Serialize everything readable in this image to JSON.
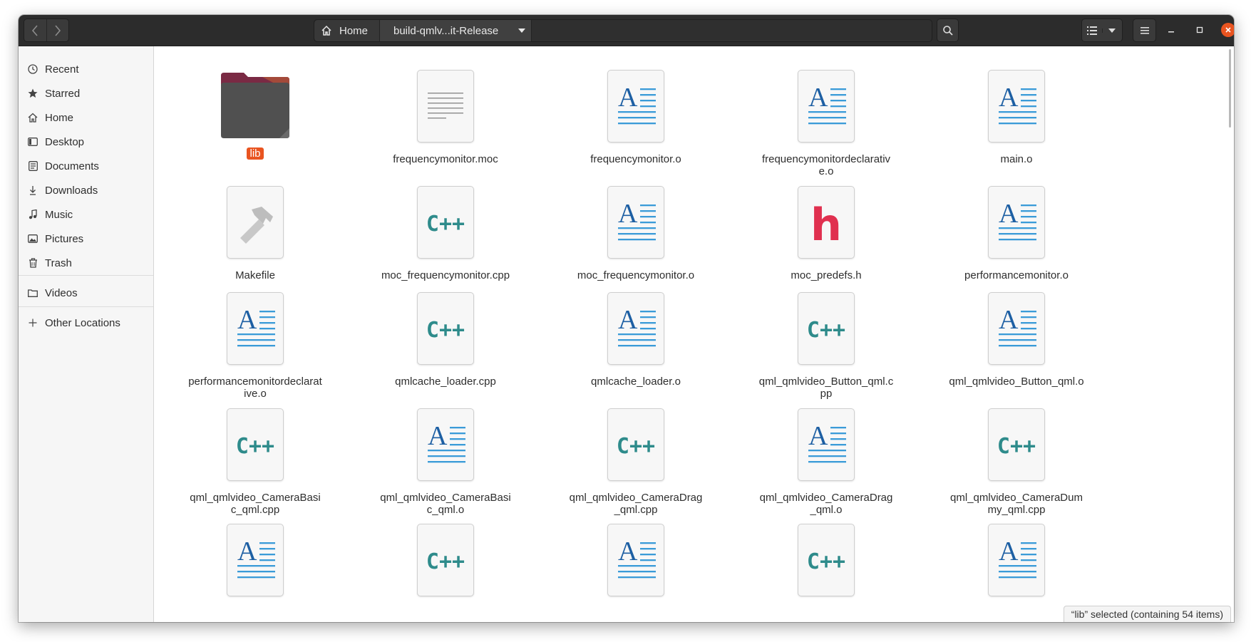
{
  "header": {
    "back_icon": "go-back-icon",
    "forward_icon": "go-forward-icon",
    "path": {
      "home_label": "Home",
      "current_label": "build-qmlv...it-Release"
    },
    "search_icon": "search-icon",
    "view_icon": "list-view-icon",
    "menu_icon": "hamburger-menu-icon",
    "close_color": "#e95420"
  },
  "sidebar": {
    "items": [
      {
        "label": "Recent",
        "icon": "recent-icon"
      },
      {
        "label": "Starred",
        "icon": "star-icon"
      },
      {
        "label": "Home",
        "icon": "home-icon"
      },
      {
        "label": "Desktop",
        "icon": "desktop-icon"
      },
      {
        "label": "Documents",
        "icon": "documents-icon"
      },
      {
        "label": "Downloads",
        "icon": "downloads-icon"
      },
      {
        "label": "Music",
        "icon": "music-icon"
      },
      {
        "label": "Pictures",
        "icon": "pictures-icon"
      },
      {
        "label": "Trash",
        "icon": "trash-icon"
      },
      {
        "label": "Videos",
        "icon": "videos-icon"
      },
      {
        "label": "Other Locations",
        "icon": "plus-icon"
      }
    ]
  },
  "files": [
    {
      "name": "lib",
      "type": "folder",
      "selected": true
    },
    {
      "name": "frequencymonitor.moc",
      "type": "text"
    },
    {
      "name": "frequencymonitor.o",
      "type": "object"
    },
    {
      "name": "frequencymonitordeclarative.o",
      "type": "object"
    },
    {
      "name": "main.o",
      "type": "object"
    },
    {
      "name": "Makefile",
      "type": "makefile"
    },
    {
      "name": "moc_frequencymonitor.cpp",
      "type": "cpp"
    },
    {
      "name": "moc_frequencymonitor.o",
      "type": "object"
    },
    {
      "name": "moc_predefs.h",
      "type": "header"
    },
    {
      "name": "performancemonitor.o",
      "type": "object"
    },
    {
      "name": "performancemonitordeclarative.o",
      "type": "object"
    },
    {
      "name": "qmlcache_loader.cpp",
      "type": "cpp"
    },
    {
      "name": "qmlcache_loader.o",
      "type": "object"
    },
    {
      "name": "qml_qmlvideo_Button_qml.cpp",
      "type": "cpp"
    },
    {
      "name": "qml_qmlvideo_Button_qml.o",
      "type": "object"
    },
    {
      "name": "qml_qmlvideo_CameraBasic_qml.cpp",
      "type": "cpp"
    },
    {
      "name": "qml_qmlvideo_CameraBasic_qml.o",
      "type": "object"
    },
    {
      "name": "qml_qmlvideo_CameraDrag_qml.cpp",
      "type": "cpp"
    },
    {
      "name": "qml_qmlvideo_CameraDrag_qml.o",
      "type": "object"
    },
    {
      "name": "qml_qmlvideo_CameraDummy_qml.cpp",
      "type": "cpp"
    },
    {
      "name": "",
      "type": "object"
    },
    {
      "name": "",
      "type": "cpp"
    },
    {
      "name": "",
      "type": "object"
    },
    {
      "name": "",
      "type": "cpp"
    },
    {
      "name": "",
      "type": "object"
    }
  ],
  "status": {
    "text": "“lib” selected  (containing 54 items)"
  },
  "colors": {
    "accent": "#e95420",
    "cpp": "#2e8b8b",
    "object_letter": "#1d5fa3",
    "object_lines": "#3a9bd8",
    "header_h": "#e0304f"
  }
}
